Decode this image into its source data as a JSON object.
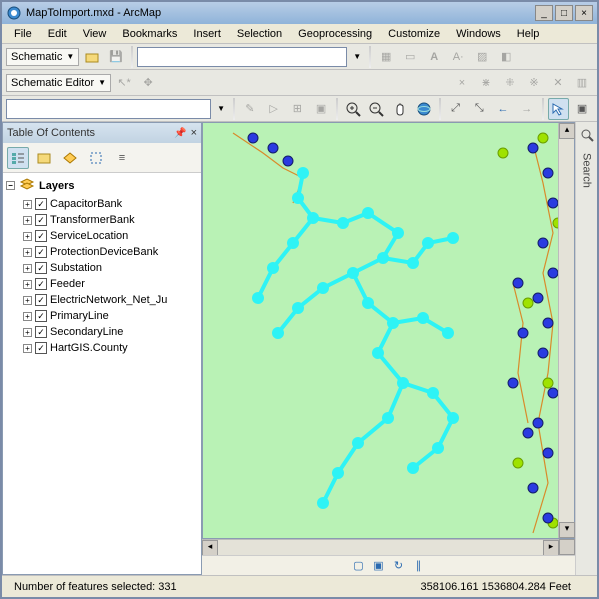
{
  "window": {
    "title": "MapToImport.mxd - ArcMap"
  },
  "menu": [
    "File",
    "Edit",
    "View",
    "Bookmarks",
    "Insert",
    "Selection",
    "Geoprocessing",
    "Customize",
    "Windows",
    "Help"
  ],
  "toolbar1": {
    "schematic_label": "Schematic"
  },
  "toolbar2": {
    "schematic_editor_label": "Schematic Editor"
  },
  "toc": {
    "title": "Table Of Contents",
    "root": "Layers",
    "items": [
      {
        "label": "CapacitorBank",
        "checked": true
      },
      {
        "label": "TransformerBank",
        "checked": true
      },
      {
        "label": "ServiceLocation",
        "checked": true
      },
      {
        "label": "ProtectionDeviceBank",
        "checked": true
      },
      {
        "label": "Substation",
        "checked": true
      },
      {
        "label": "Feeder",
        "checked": true
      },
      {
        "label": "ElectricNetwork_Net_Ju",
        "checked": true
      },
      {
        "label": "PrimaryLine",
        "checked": true
      },
      {
        "label": "SecondaryLine",
        "checked": true
      },
      {
        "label": "HartGIS.County",
        "checked": true
      }
    ]
  },
  "sidebar": {
    "search": "Search"
  },
  "status": {
    "selected": "Number of features selected: 331",
    "coords": "358106.161  1536804.284 Feet"
  },
  "colors": {
    "map_bg": "#b9f2b5",
    "cyan": "#2ef3f5",
    "blue": "#2a3be0",
    "lime": "#9fe200",
    "orange": "#d98a2a"
  }
}
